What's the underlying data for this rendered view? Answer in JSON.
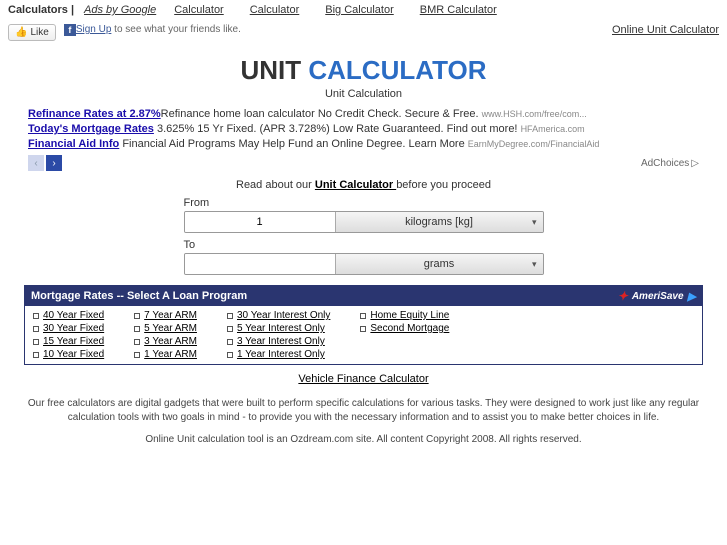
{
  "topbar": {
    "calculators_label": "Calculators |",
    "ads_by_google": "Ads by Google",
    "links": [
      "Calculator",
      "Calculator",
      "Big Calculator",
      "BMR Calculator"
    ]
  },
  "fb": {
    "like": "Like",
    "signup": "Sign Up",
    "text": " to see what your friends like."
  },
  "top_right": "Online Unit Calculator",
  "title": {
    "part1": "UNIT ",
    "part2": "CALCULATOR"
  },
  "subtitle": "Unit Calculation",
  "ads": [
    {
      "title": "Refinance Rates at 2.87%",
      "desc": "Refinance home loan calculator No Credit Check. Secure & Free. ",
      "src": "www.HSH.com/free/com..."
    },
    {
      "title": "Today's Mortgage Rates",
      "desc": " 3.625% 15 Yr Fixed. (APR 3.728%) Low Rate Guaranteed. Find out more! ",
      "src": "HFAmerica.com"
    },
    {
      "title": "Financial Aid Info",
      "desc": " Financial Aid Programs May Help Fund an Online Degree. Learn More ",
      "src": "EarnMyDegree.com/FinancialAid"
    }
  ],
  "adchoices": "AdChoices",
  "read_about": {
    "pre": "Read about our ",
    "link": "Unit Calculator ",
    "post": "before you proceed"
  },
  "converter": {
    "from_label": "From",
    "from_value": "1",
    "from_unit": "kilograms [kg]",
    "to_label": "To",
    "to_value": "",
    "to_unit": "grams"
  },
  "mortgage": {
    "header": "Mortgage Rates  --  Select A Loan Program",
    "brand": "AmeriSave",
    "cols": [
      [
        "40 Year Fixed",
        "30 Year Fixed",
        "15 Year Fixed",
        "10 Year Fixed"
      ],
      [
        "7 Year ARM",
        "5 Year ARM",
        "3 Year ARM",
        "1 Year ARM"
      ],
      [
        "30 Year Interest Only",
        "5 Year Interest Only",
        "3 Year Interest Only",
        "1 Year Interest Only"
      ],
      [
        "Home Equity Line",
        "Second Mortgage"
      ]
    ]
  },
  "vehicle_link": "Vehicle Finance Calculator",
  "footer1": "Our free calculators are digital gadgets that were built to perform specific calculations for various tasks. They were designed to work just like any regular calculation tools with two goals in mind - to provide you with the necessary information and to assist you to make better choices in life.",
  "footer2": "Online Unit calculation tool is an Ozdream.com site. All content Copyright 2008. All rights reserved."
}
